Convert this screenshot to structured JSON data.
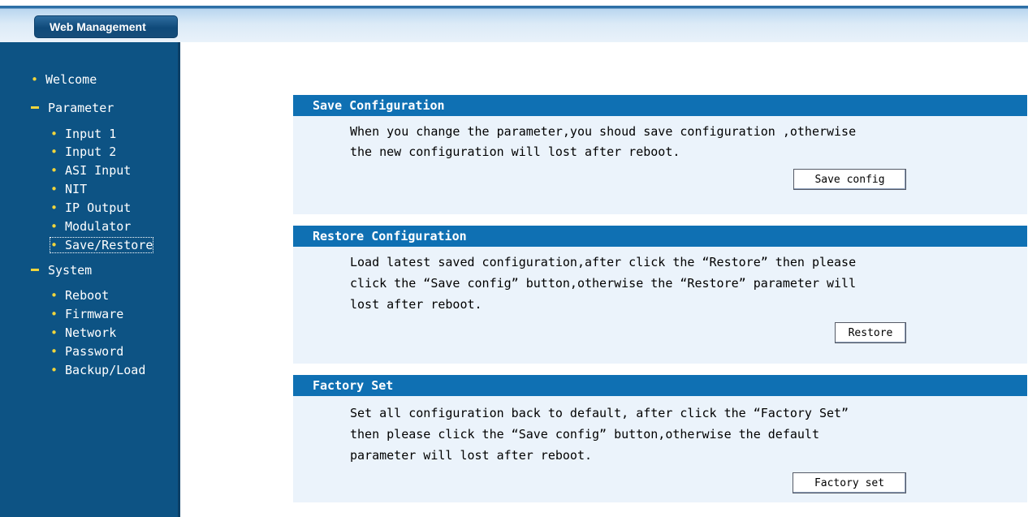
{
  "header": {
    "tab_label": "Web Management"
  },
  "sidebar": {
    "welcome": "Welcome",
    "parameter": {
      "label": "Parameter",
      "items": [
        "Input 1",
        "Input 2",
        "ASI Input",
        "NIT",
        "IP Output",
        "Modulator",
        "Save/Restore"
      ]
    },
    "system": {
      "label": "System",
      "items": [
        "Reboot",
        "Firmware",
        "Network",
        "Password",
        "Backup/Load"
      ]
    },
    "active_item": "Save/Restore"
  },
  "main": {
    "save_config": {
      "title": "Save Configuration",
      "lines": [
        "When you change the parameter,you shoud save configuration ,otherwise",
        "the new configuration will lost after reboot."
      ],
      "button_label": "Save config"
    },
    "restore_config": {
      "title": "Restore Configuration",
      "lines": [
        "Load latest saved configuration,after click the “Restore” then please",
        "click the “Save config” button,otherwise the “Restore” parameter will",
        "lost after reboot."
      ],
      "button_label": "Restore"
    },
    "factory_set": {
      "title": "Factory Set",
      "lines": [
        "Set all configuration back to default, after click the “Factory Set”",
        "then please click the “Save config” button,otherwise the default",
        "parameter will lost after reboot."
      ],
      "button_label": "Factory set"
    }
  },
  "colors": {
    "sidebar_bg": "#0d5384",
    "panel_title_bg": "#0f70b3",
    "panel_body_bg": "#ebf3fb",
    "bullet": "#f0d53c"
  }
}
